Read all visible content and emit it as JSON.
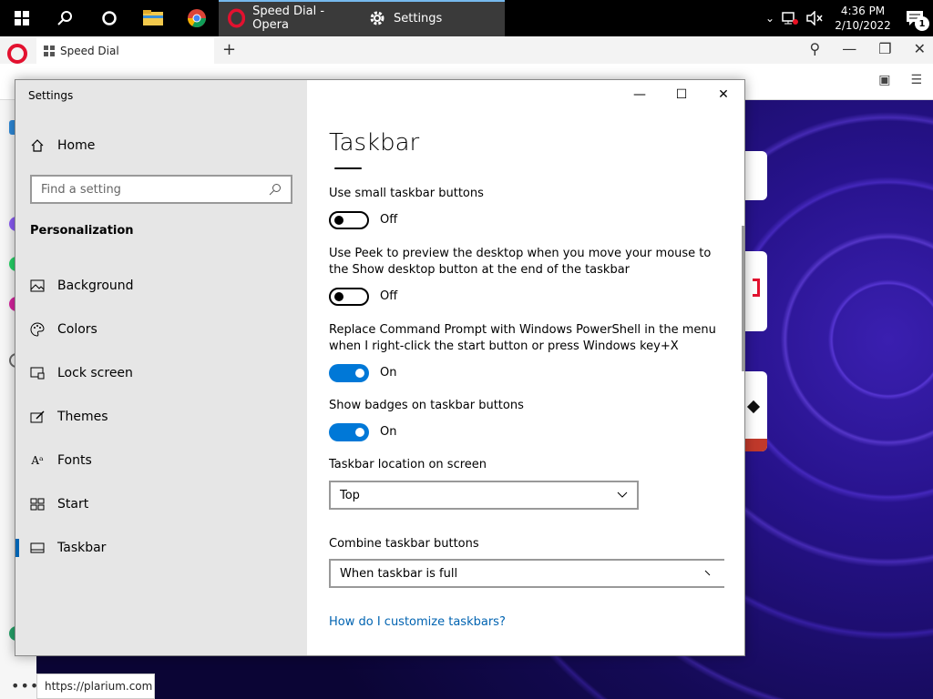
{
  "taskbar": {
    "apps": [
      {
        "label": "Speed Dial - Opera"
      },
      {
        "label": "Settings"
      }
    ],
    "clock": {
      "time": "4:36 PM",
      "date": "2/10/2022"
    },
    "notification_count": "1"
  },
  "browser": {
    "tab_label": "Speed Dial",
    "new_tab": "+",
    "status_url": "https://plarium.com"
  },
  "settings": {
    "window_title": "Settings",
    "nav": {
      "home": "Home",
      "search_placeholder": "Find a setting",
      "section": "Personalization",
      "items": [
        {
          "label": "Background",
          "icon": "picture-icon"
        },
        {
          "label": "Colors",
          "icon": "palette-icon"
        },
        {
          "label": "Lock screen",
          "icon": "lock-screen-icon"
        },
        {
          "label": "Themes",
          "icon": "themes-icon"
        },
        {
          "label": "Fonts",
          "icon": "fonts-icon"
        },
        {
          "label": "Start",
          "icon": "start-icon"
        },
        {
          "label": "Taskbar",
          "icon": "taskbar-icon"
        }
      ]
    },
    "page": {
      "title": "Taskbar",
      "small_buttons": {
        "label": "Use small taskbar buttons",
        "state": "Off"
      },
      "peek": {
        "label": "Use Peek to preview the desktop when you move your mouse to the Show desktop button at the end of the taskbar",
        "state": "Off"
      },
      "powershell": {
        "label": "Replace Command Prompt with Windows PowerShell in the menu when I right-click the start button or press Windows key+X",
        "state": "On"
      },
      "badges": {
        "label": "Show badges on taskbar buttons",
        "state": "On"
      },
      "location": {
        "label": "Taskbar location on screen",
        "value": "Top"
      },
      "combine": {
        "label": "Combine taskbar buttons",
        "value": "When taskbar is full"
      },
      "help_link": "How do I customize taskbars?"
    }
  },
  "colors": {
    "accent": "#0078d7",
    "link": "#0063b1",
    "opera_red": "#e3112f"
  }
}
